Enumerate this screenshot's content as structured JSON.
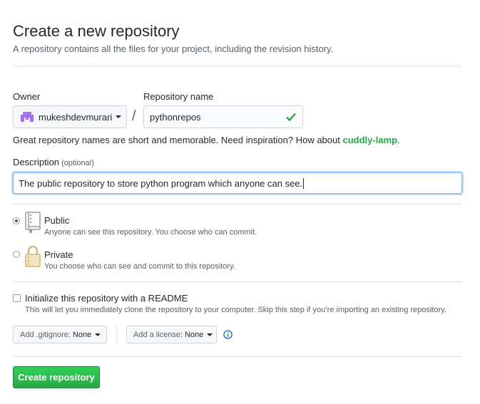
{
  "header": {
    "title": "Create a new repository",
    "subtitle": "A repository contains all the files for your project, including the revision history."
  },
  "owner": {
    "label": "Owner",
    "value": "mukeshdevmurari",
    "avatar_icon": "identicon-avatar",
    "avatar_color": "#a371f7"
  },
  "slash": "/",
  "repo": {
    "label": "Repository name",
    "value": "pythonrepos",
    "valid_icon": "check-icon",
    "valid_color": "#28a745"
  },
  "hint": {
    "text": "Great repository names are short and memorable. Need inspiration? How about ",
    "suggestion": "cuddly-lamp",
    "end": "."
  },
  "description": {
    "label": "Description",
    "optional": "(optional)",
    "value": "The public repository to store python program which anyone can see."
  },
  "visibility": {
    "public": {
      "label": "Public",
      "desc": "Anyone can see this repository. You choose who can commit.",
      "icon": "repo-book-icon",
      "selected": true
    },
    "private": {
      "label": "Private",
      "desc": "You choose who can see and commit to this repository.",
      "icon": "lock-icon",
      "selected": false
    }
  },
  "readme": {
    "label": "Initialize this repository with a README",
    "desc": "This will let you immediately clone the repository to your computer. Skip this step if you’re importing an existing repository.",
    "checked": false
  },
  "gitignore": {
    "prefix": "Add .gitignore:",
    "value": "None"
  },
  "license": {
    "prefix": "Add a license:",
    "value": "None"
  },
  "info_icon": "info-icon",
  "submit": {
    "label": "Create repository",
    "color": "#28a745"
  }
}
